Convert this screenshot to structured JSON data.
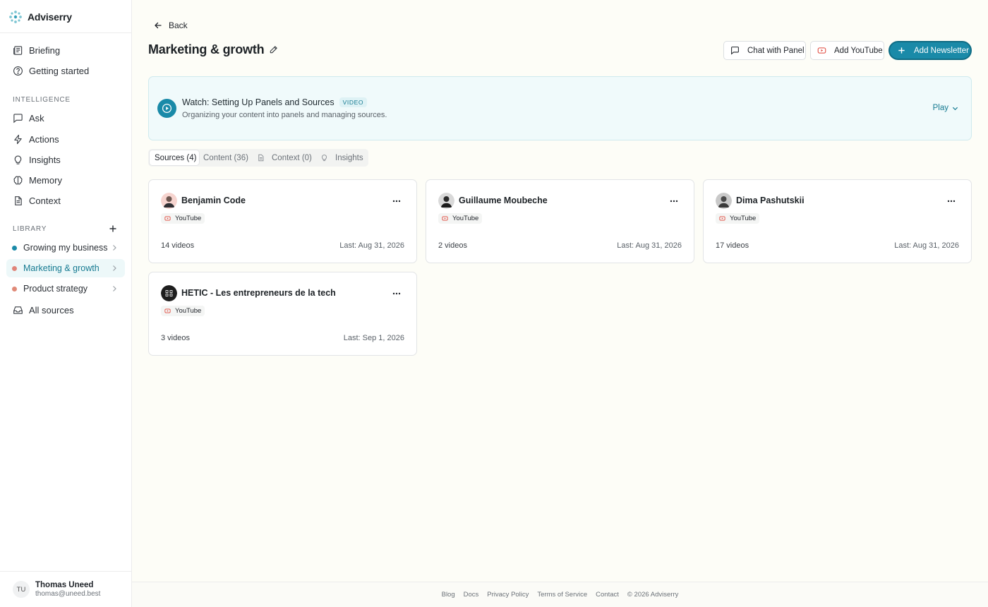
{
  "brand": {
    "name": "Adviserry"
  },
  "nav": {
    "primary": [
      {
        "label": "Briefing",
        "icon": "newspaper-icon"
      },
      {
        "label": "Getting started",
        "icon": "help-circle-icon"
      }
    ],
    "intelligence_label": "INTELLIGENCE",
    "intelligence": [
      {
        "label": "Ask",
        "icon": "message-square-icon"
      },
      {
        "label": "Actions",
        "icon": "zap-icon"
      },
      {
        "label": "Insights",
        "icon": "lightbulb-icon"
      },
      {
        "label": "Memory",
        "icon": "brain-icon"
      },
      {
        "label": "Context",
        "icon": "file-text-icon"
      }
    ],
    "library_label": "LIBRARY",
    "library": [
      {
        "label": "Growing my business",
        "color": "#1a8aa8",
        "active": false
      },
      {
        "label": "Marketing & growth",
        "color": "#e0857a",
        "active": true
      },
      {
        "label": "Product strategy",
        "color": "#e08a78",
        "active": false
      }
    ],
    "all_sources": "All sources"
  },
  "user": {
    "initials": "TU",
    "name": "Thomas Uneed",
    "email": "thomas@uneed.best"
  },
  "header": {
    "back": "Back",
    "title": "Marketing & growth",
    "chat_button": "Chat with Panel",
    "youtube_button": "Add YouTube",
    "newsletter_button": "Add Newsletter"
  },
  "video": {
    "title": "Watch: Setting Up Panels and Sources",
    "badge": "VIDEO",
    "description": "Organizing your content into panels and managing sources.",
    "play": "Play"
  },
  "tabs": [
    {
      "label": "Sources (4)",
      "active": true
    },
    {
      "label": "Content (36)",
      "active": false
    },
    {
      "label": "Context (0)",
      "active": false
    },
    {
      "label": "Insights",
      "active": false
    }
  ],
  "sources": [
    {
      "name": "Benjamin Code",
      "platform": "YouTube",
      "count": "14 videos",
      "last": "Last: Aug 31, 2026"
    },
    {
      "name": "Guillaume Moubeche",
      "platform": "YouTube",
      "count": "2 videos",
      "last": "Last: Aug 31, 2026"
    },
    {
      "name": "Dima Pashutskii",
      "platform": "YouTube",
      "count": "17 videos",
      "last": "Last: Aug 31, 2026"
    },
    {
      "name": "HETIC - Les entrepreneurs de la tech",
      "platform": "YouTube",
      "count": "3 videos",
      "last": "Last: Sep 1, 2026"
    }
  ],
  "footer": [
    "Blog",
    "Docs",
    "Privacy Policy",
    "Terms of Service",
    "Contact",
    "© 2026 Adviserry"
  ],
  "colors": {
    "accent": "#1a8aa8",
    "accent_text": "#157a91",
    "youtube": "#e0463a"
  }
}
